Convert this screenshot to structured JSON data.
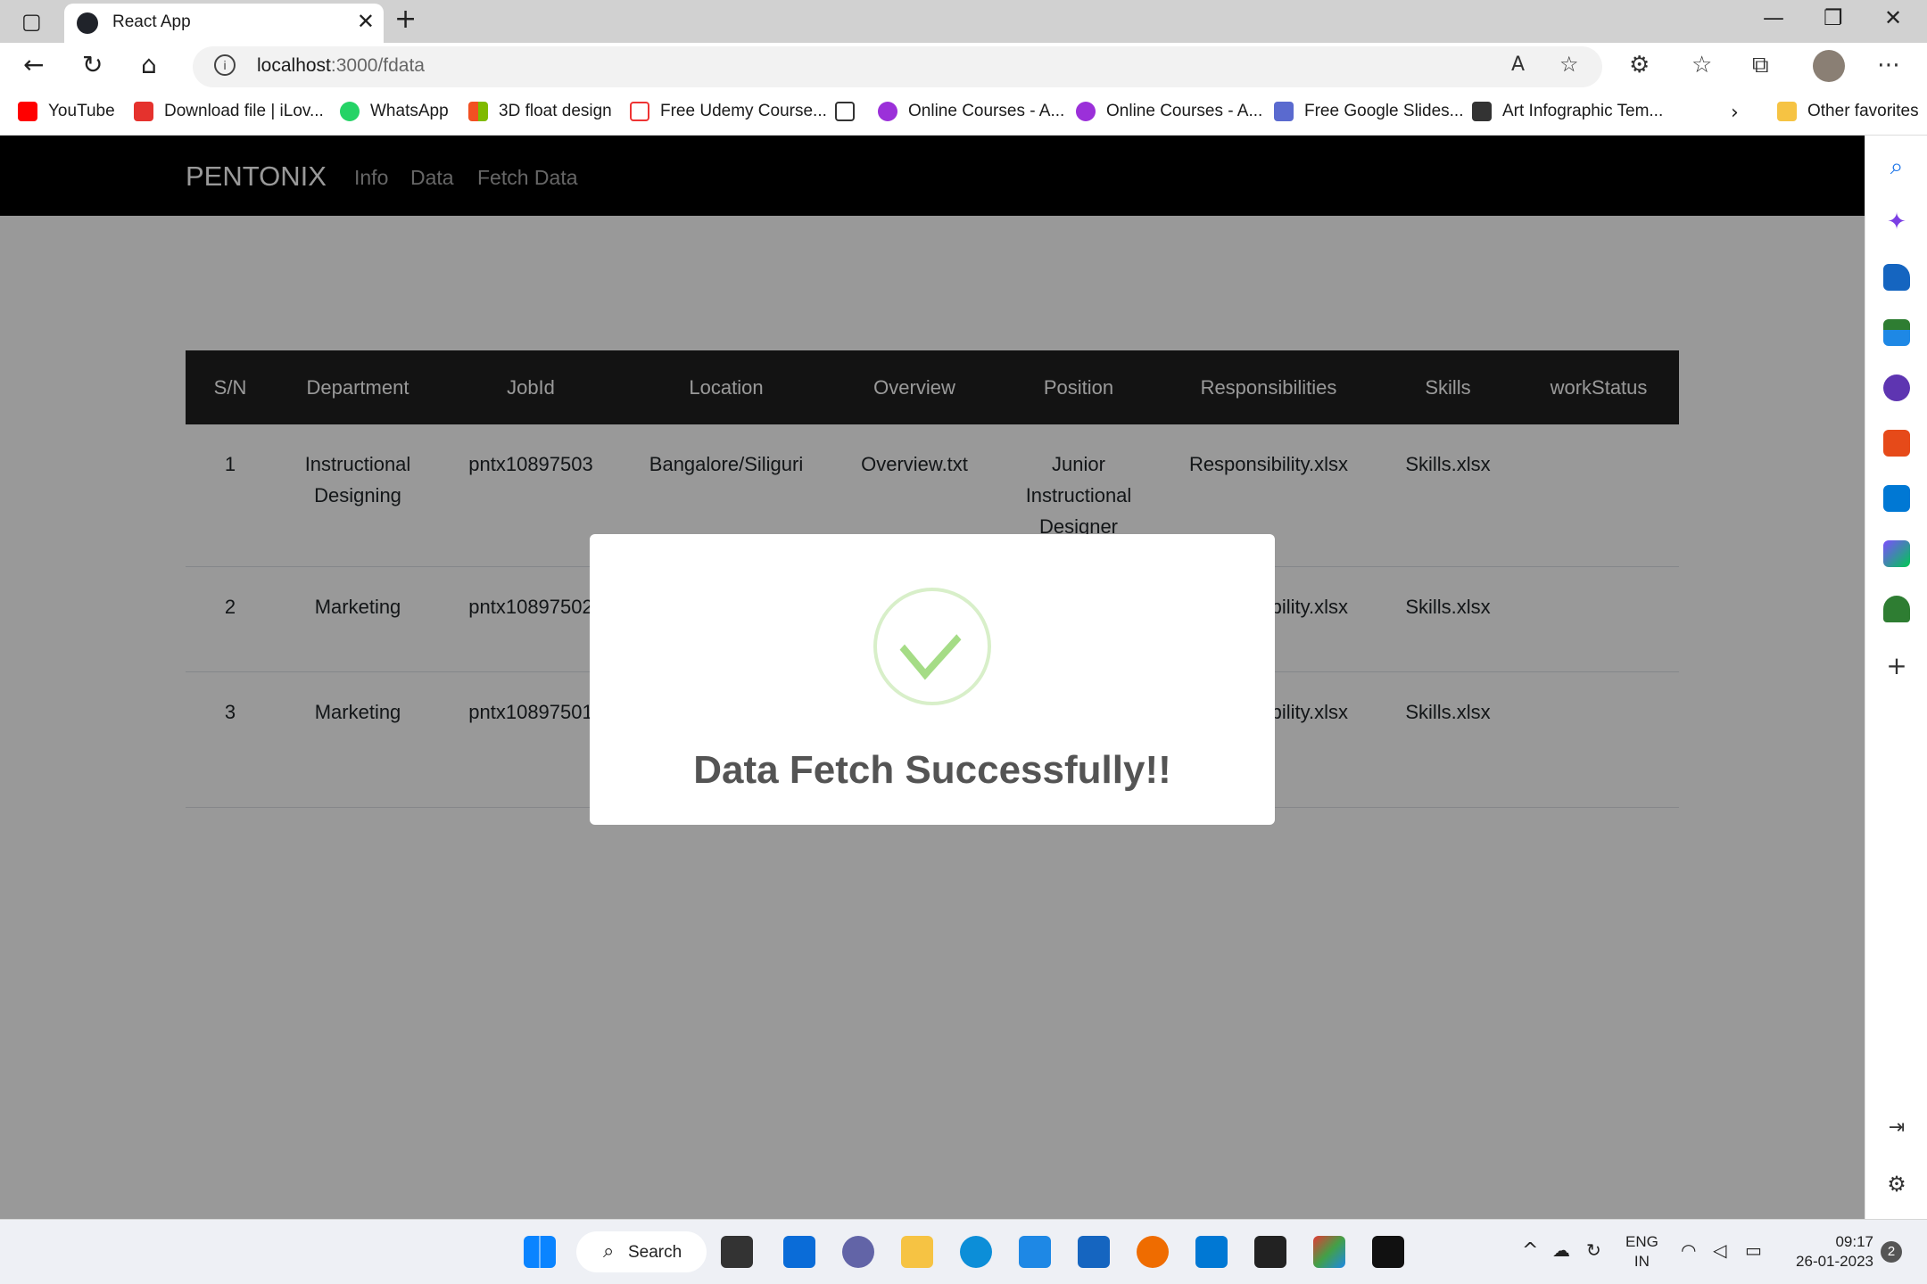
{
  "browser": {
    "tab_title": "React App",
    "url_host": "localhost",
    "url_path": ":3000/fdata",
    "bookmarks": [
      "YouTube",
      "Download file | iLov...",
      "WhatsApp",
      "3D float design",
      "Free Udemy Course...",
      "Online Courses - A...",
      "Online Courses - A...",
      "Free Google Slides...",
      "Art Infographic Tem...",
      "Other favorites"
    ]
  },
  "app": {
    "brand": "PENTONIX",
    "nav": [
      "Info",
      "Data",
      "Fetch Data"
    ]
  },
  "table": {
    "headers": [
      "S/N",
      "Department",
      "JobId",
      "Location",
      "Overview",
      "Position",
      "Responsibilities",
      "Skills",
      "workStatus"
    ],
    "rows": [
      [
        "1",
        "Instructional Designing",
        "pntx10897503",
        "Bangalore/Siliguri",
        "Overview.txt",
        "Junior Instructional Designer",
        "Responsibility.xlsx",
        "Skills.xlsx",
        ""
      ],
      [
        "2",
        "Marketing",
        "pntx10897502",
        "",
        "",
        "",
        "Responsibility.xlsx",
        "Skills.xlsx",
        ""
      ],
      [
        "3",
        "Marketing",
        "pntx10897501",
        "",
        "",
        "",
        "Responsibility.xlsx",
        "Skills.xlsx",
        ""
      ]
    ]
  },
  "modal": {
    "title": "Data Fetch Successfully!!"
  },
  "taskbar": {
    "search_label": "Search",
    "lang_line1": "ENG",
    "lang_line2": "IN",
    "time": "09:17",
    "date": "26-01-2023",
    "notification_count": "2"
  },
  "colors": {
    "navbar": "#000000",
    "table_header": "#212121",
    "success_green": "#a5dc86",
    "overlay": "rgba(0,0,0,0.4)"
  }
}
